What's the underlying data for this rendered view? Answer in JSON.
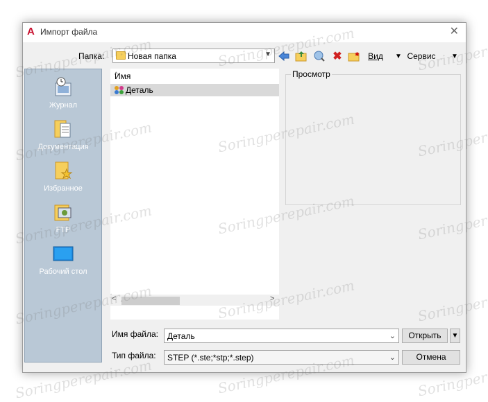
{
  "window": {
    "title": "Импорт файла"
  },
  "folder": {
    "label": "Папка:",
    "value": "Новая папка"
  },
  "toolbar": {
    "view_label": "Вид",
    "tools_label": "Сервис"
  },
  "places": [
    {
      "label": "Журнал",
      "icon": "history-icon"
    },
    {
      "label": "Документация",
      "icon": "documents-icon"
    },
    {
      "label": "Избранное",
      "icon": "favorites-icon"
    },
    {
      "label": "FTP",
      "icon": "ftp-icon"
    },
    {
      "label": "Рабочий стол",
      "icon": "desktop-icon"
    }
  ],
  "file_list": {
    "column_header": "Имя",
    "items": [
      {
        "name": "Деталь",
        "selected": true
      }
    ]
  },
  "preview": {
    "label": "Просмотр"
  },
  "filename": {
    "label": "Имя файла:",
    "value": "Деталь"
  },
  "filetype": {
    "label": "Тип файла:",
    "value": "STEP (*.ste;*stp;*.step)"
  },
  "buttons": {
    "open": "Открыть",
    "cancel": "Отмена"
  },
  "watermark": "Soringperepair.com",
  "colors": {
    "places_bg": "#b9c8d6",
    "selection": "#d9d9d9",
    "accent_red": "#c8102e"
  }
}
